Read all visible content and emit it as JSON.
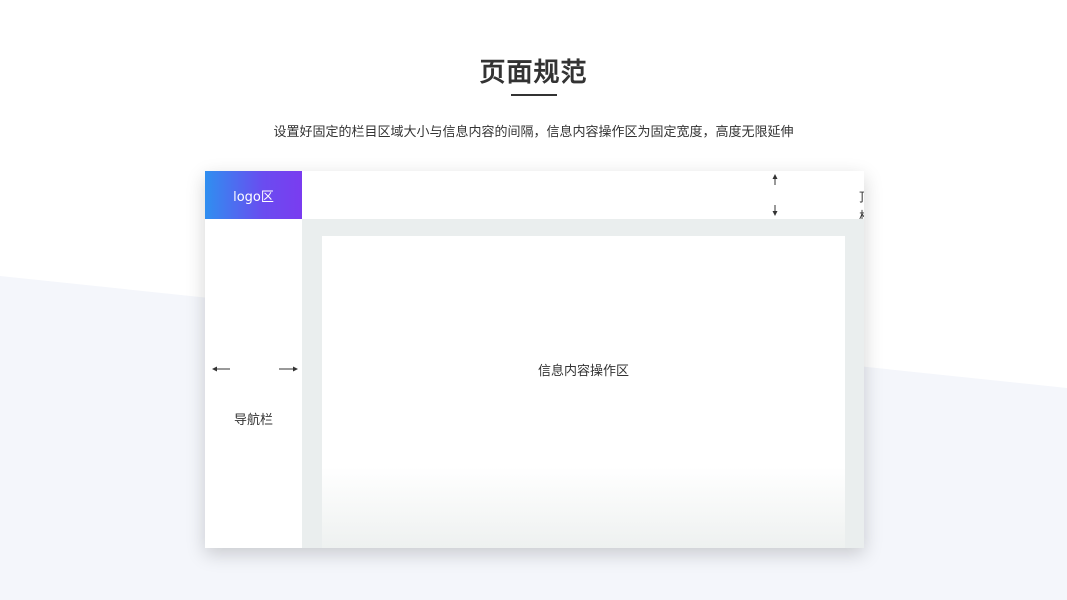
{
  "page": {
    "title": "页面规范",
    "subtitle": "设置好固定的栏目区域大小与信息内容的间隔，信息内容操作区为固定宽度，高度无限延伸"
  },
  "layout_diagram": {
    "logo_label": "logo区",
    "topbar_label": "顶栏",
    "nav_label": "导航栏",
    "content_label": "信息内容操作区"
  },
  "colors": {
    "background_band": "#f4f6fb",
    "logo_gradient_start": "#2f8ff0",
    "logo_gradient_end": "#7a3cf0",
    "content_bg": "#eaeeee",
    "text": "#333333"
  }
}
